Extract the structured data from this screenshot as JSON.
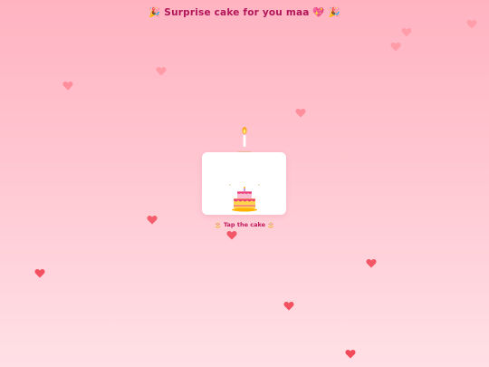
{
  "header": {
    "title": "🎉 Surprise cake for you maa 💖 🎉"
  },
  "cake_card": {
    "instruction": "🎂 Tap the cake 🎂"
  },
  "colors": {
    "background_top": "#ffb3c1",
    "background_bottom": "#ffe0e6",
    "heart_strong": "#f24a5a",
    "heart_soft": "#ff8a96",
    "title": "#b3155a"
  },
  "icons": {
    "heart": "heart-icon",
    "candle": "candle-icon",
    "cake": "cake-icon"
  }
}
